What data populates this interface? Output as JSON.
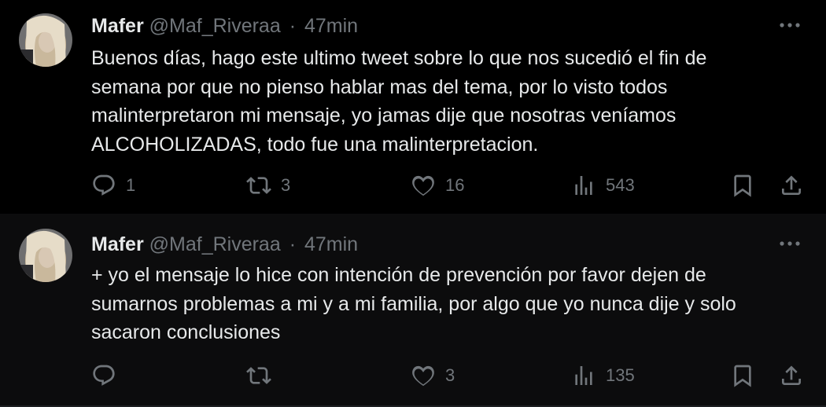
{
  "tweets": [
    {
      "author": {
        "name": "Mafer",
        "handle": "@Maf_Riveraa",
        "separator": "·",
        "time": "47min"
      },
      "text": "Buenos días, hago este ultimo tweet sobre lo que nos sucedió el fin de\nsemana por que no pienso hablar mas del tema, por lo visto todos\nmalinterpretaron mi mensaje, yo jamas dije que nosotras veníamos\nALCOHOLIZADAS, todo fue una malinterpretacion.",
      "stats": {
        "replies": "1",
        "retweets": "3",
        "likes": "16",
        "views": "543"
      }
    },
    {
      "author": {
        "name": "Mafer",
        "handle": "@Maf_Riveraa",
        "separator": "·",
        "time": "47min"
      },
      "text": "+ yo el mensaje lo hice con intención de prevención por favor dejen de\nsumarnos problemas a mi y a mi familia, por algo que yo nunca dije y solo\nsacaron conclusiones",
      "stats": {
        "replies": "",
        "retweets": "",
        "likes": "3",
        "views": "135"
      }
    }
  ],
  "icons": {
    "reply": "reply-icon",
    "retweet": "retweet-icon",
    "like": "heart-icon",
    "views": "views-chart-icon",
    "bookmark": "bookmark-icon",
    "share": "share-icon",
    "more": "more-dots-icon"
  },
  "colors": {
    "background": "#000000",
    "text": "#e7e9ea",
    "muted": "#71767b",
    "thread_line": "#3a3d41"
  }
}
